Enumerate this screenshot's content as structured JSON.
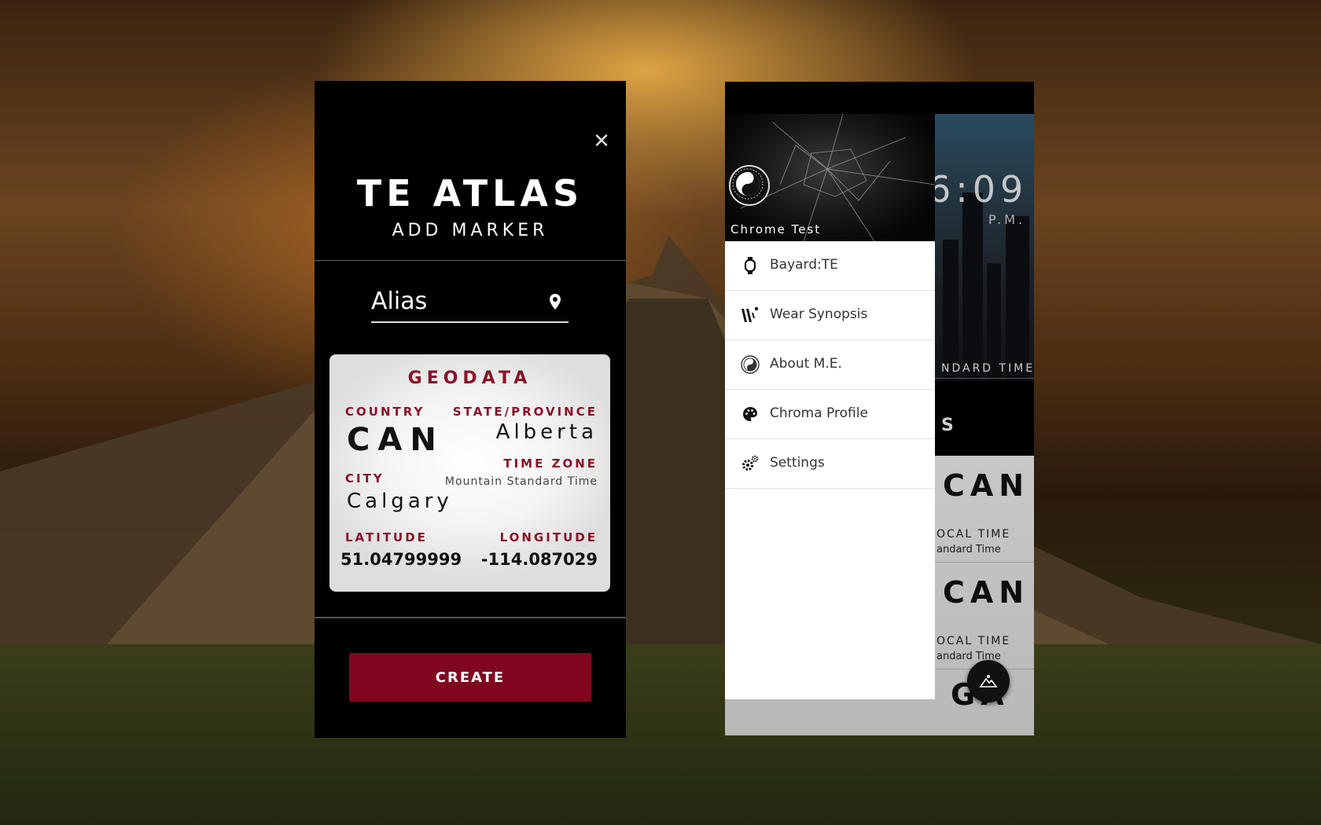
{
  "left_panel": {
    "close_icon": "close-icon",
    "app_title": "TE ATLAS",
    "subtitle": "ADD MARKER",
    "alias": {
      "placeholder": "Alias",
      "value": "",
      "icon": "map-pin-icon"
    },
    "geodata": {
      "title": "GEODATA",
      "country_label": "COUNTRY",
      "country_value": "CAN",
      "state_label": "STATE/PROVINCE",
      "state_value": "Alberta",
      "city_label": "CITY",
      "city_value": "Calgary",
      "timezone_label": "TIME ZONE",
      "timezone_value": "Mountain Standard Time",
      "latitude_label": "LATITUDE",
      "latitude_value": "51.04799999",
      "longitude_label": "LONGITUDE",
      "longitude_value": "-114.087029"
    },
    "create_label": "CREATE",
    "colors": {
      "accent": "#82051f",
      "label": "#8a1128"
    }
  },
  "right_panel": {
    "background": {
      "clock": "6:09",
      "period": "P.M.",
      "standard_time": "NDARD TIME",
      "section_fragment": "S",
      "rows": [
        {
          "code": "CAN",
          "local_time_label": "OCAL TIME",
          "zone": "andard Time"
        },
        {
          "code": "CAN",
          "local_time_label": "OCAL TIME",
          "zone": "andard Time"
        },
        {
          "code": "GA"
        }
      ],
      "fab_icon": "map-landscape-icon"
    },
    "drawer": {
      "profile_name": "Chrome Test",
      "avatar_icon": "yin-yang-icon",
      "items": [
        {
          "label": "Bayard:TE",
          "icon": "watch-icon"
        },
        {
          "label": "Wear Synopsis",
          "icon": "wear-synopsis-icon"
        },
        {
          "label": "About M.E.",
          "icon": "about-me-icon"
        },
        {
          "label": "Chroma Profile",
          "icon": "palette-icon"
        },
        {
          "label": "Settings",
          "icon": "gears-icon"
        }
      ]
    }
  }
}
